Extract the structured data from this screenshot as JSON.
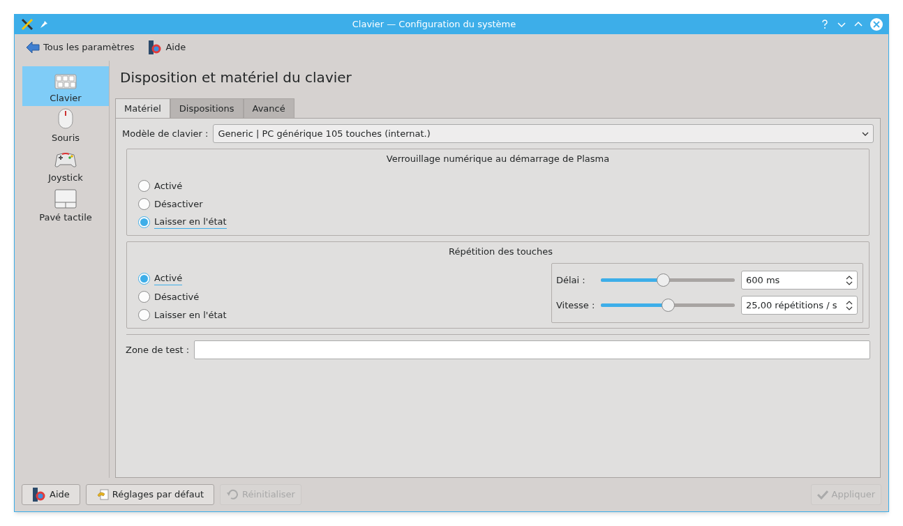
{
  "window": {
    "title": "Clavier — Configuration du système"
  },
  "toolbar": [
    {
      "kind": "back",
      "label": "Tous les paramètres"
    },
    {
      "kind": "help",
      "label": "Aide"
    }
  ],
  "sidebar": {
    "items": [
      {
        "kind": "keyboard",
        "label": "Clavier",
        "selected": true
      },
      {
        "kind": "mouse",
        "label": "Souris",
        "selected": false
      },
      {
        "kind": "gamepad",
        "label": "Joystick",
        "selected": false
      },
      {
        "kind": "touchpad",
        "label": "Pavé tactile",
        "selected": false
      }
    ]
  },
  "heading": "Disposition et matériel du clavier",
  "tabs": [
    {
      "label": "Matériel",
      "selected": true
    },
    {
      "label": "Dispositions",
      "selected": false
    },
    {
      "label": "Avancé",
      "selected": false
    }
  ],
  "model": {
    "label": "Modèle de clavier :",
    "value": "Generic | PC générique 105 touches (internat.)"
  },
  "numlock": {
    "title": "Verrouillage numérique au démarrage de Plasma",
    "options": [
      {
        "label": "Activé",
        "selected": false
      },
      {
        "label": "Désactiver",
        "selected": false
      },
      {
        "label": "Laisser en l'état",
        "selected": true
      }
    ]
  },
  "repeat": {
    "title": "Répétition des touches",
    "options": [
      {
        "label": "Activé",
        "selected": true
      },
      {
        "label": "Désactivé",
        "selected": false
      },
      {
        "label": "Laisser en l'état",
        "selected": false
      }
    ],
    "sliders": [
      {
        "label": "Délai :",
        "level": 0.46,
        "value": "600 ms"
      },
      {
        "label": "Vitesse :",
        "level": 0.5,
        "value": "25,00 répétitions / s"
      }
    ]
  },
  "test": {
    "label": "Zone de test :"
  },
  "buttons": [
    {
      "kind": "help",
      "label": "Aide",
      "disabled": false
    },
    {
      "kind": "defaults",
      "label": "Réglages par défaut",
      "disabled": false
    },
    {
      "kind": "reset",
      "label": "Réinitialiser",
      "disabled": true
    },
    {
      "kind": "apply",
      "label": "Appliquer",
      "disabled": true
    }
  ]
}
